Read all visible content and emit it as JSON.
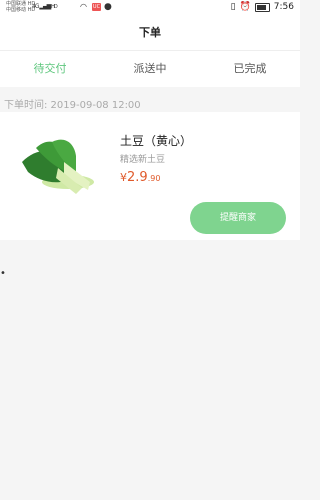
{
  "status_bar": {
    "carrier_1": "中国联通 HD",
    "carrier_2": "中国移动 HD",
    "signal_left": "4G",
    "hd_badge": "HD",
    "app_badge": "UC",
    "alarm_icon": "alarm-icon",
    "vibrate_icon": "vibrate-icon",
    "battery_icon": "battery-icon",
    "time": "7:56"
  },
  "nav": {
    "title": "下单"
  },
  "tabs": [
    {
      "label": "待交付",
      "active": true
    },
    {
      "label": "派送中",
      "active": false
    },
    {
      "label": "已完成",
      "active": false
    }
  ],
  "order": {
    "time_label": "下单时间: 2019-09-08 12:00",
    "product": {
      "name": "土豆（黄心）",
      "desc": "精选新土豆",
      "price_symbol": "¥",
      "price_main": "2.9",
      "price_small": ".90"
    },
    "remind_button": "提醒商家"
  },
  "colors": {
    "accent": "#5fc77e",
    "button": "#7fd48f",
    "price": "#e05a2b",
    "background": "#f5f5f5"
  },
  "misc": {
    "left_mark": "•"
  }
}
